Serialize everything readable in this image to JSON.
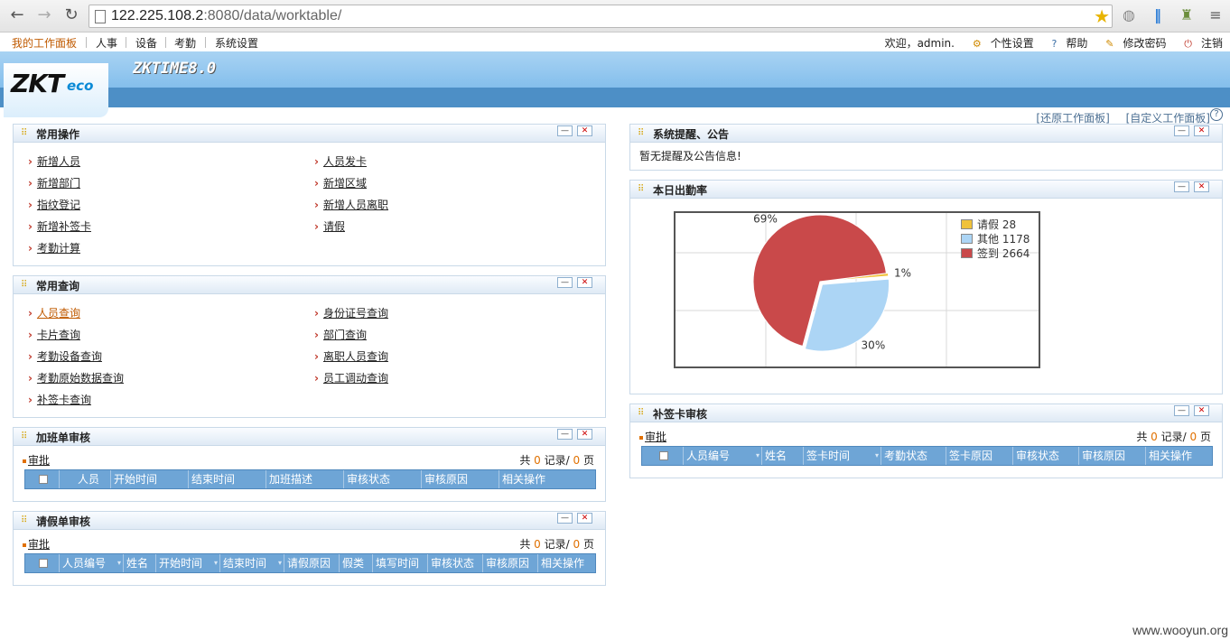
{
  "browser": {
    "url_host": "122.225.108.2",
    "url_rest": ":8080/data/worktable/"
  },
  "menu": {
    "items": [
      "我的工作面板",
      "人事",
      "设备",
      "考勤",
      "系统设置"
    ],
    "welcome": "欢迎，admin.",
    "personal": "个性设置",
    "help": "帮助",
    "password": "修改密码",
    "logout": "注销"
  },
  "brand": {
    "logo_main": "ZKT",
    "logo_sub": "eco",
    "product": "ZKTIME8.0"
  },
  "panel_links": {
    "restore": "[还原工作面板]",
    "custom": "[自定义工作面板]"
  },
  "common_ops": {
    "title": "常用操作",
    "left": [
      "新增人员",
      "新增部门",
      "指纹登记",
      "新增补签卡",
      "考勤计算"
    ],
    "right": [
      "人员发卡",
      "新增区域",
      "新增人员离职",
      "请假"
    ]
  },
  "common_query": {
    "title": "常用查询",
    "left": [
      "人员查询",
      "卡片查询",
      "考勤设备查询",
      "考勤原始数据查询",
      "补签卡查询"
    ],
    "right": [
      "身份证号查询",
      "部门查询",
      "离职人员查询",
      "员工调动查询"
    ]
  },
  "overtime": {
    "title": "加班单审核",
    "approve": "审批",
    "count_prefix": "共",
    "records": "0",
    "records_suffix": "记录/",
    "pages": "0",
    "pages_suffix": "页",
    "columns": [
      "人员",
      "开始时间",
      "结束时间",
      "加班描述",
      "审核状态",
      "审核原因",
      "相关操作"
    ]
  },
  "leave": {
    "title": "请假单审核",
    "approve": "审批",
    "count_prefix": "共",
    "records": "0",
    "records_suffix": "记录/",
    "pages": "0",
    "pages_suffix": "页",
    "columns": [
      "人员编号",
      "姓名",
      "开始时间",
      "结束时间",
      "请假原因",
      "假类",
      "填写时间",
      "审核状态",
      "审核原因",
      "相关操作"
    ]
  },
  "notice": {
    "title": "系统提醒、公告",
    "text": "暂无提醒及公告信息!"
  },
  "attendance": {
    "title": "本日出勤率"
  },
  "chart_data": {
    "type": "pie",
    "title": "",
    "series": [
      {
        "name": "请假",
        "value": 28,
        "label": "1%",
        "color": "#f0c23b"
      },
      {
        "name": "其他",
        "value": 1178,
        "label": "30%",
        "color": "#acd5f5"
      },
      {
        "name": "签到",
        "value": 2664,
        "label": "69%",
        "color": "#c9494a"
      }
    ],
    "legend": "top-right",
    "grid": true
  },
  "resign": {
    "title": "补签卡审核",
    "approve": "审批",
    "count_prefix": "共",
    "records": "0",
    "records_suffix": "记录/",
    "pages": "0",
    "pages_suffix": "页",
    "columns": [
      "人员编号",
      "姓名",
      "签卡时间",
      "考勤状态",
      "签卡原因",
      "审核状态",
      "审核原因",
      "相关操作"
    ]
  },
  "watermark": "www.wooyun.org"
}
